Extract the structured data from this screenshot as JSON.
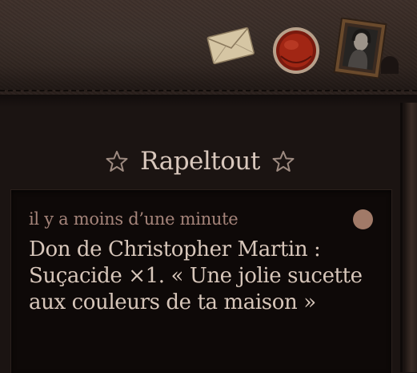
{
  "header": {
    "icons": [
      "mail-icon",
      "wax-seal-icon",
      "portrait-icon"
    ]
  },
  "panel": {
    "title": "Rapeltout",
    "title_icon": "star-outline-icon"
  },
  "notification": {
    "time": "il y a moins d’une minute",
    "message": "Don de Christopher Martin : Suçacide ×1. « Une jolie sucette aux couleurs de ta maison »",
    "unread": true
  },
  "colors": {
    "title_text": "#d9c8bd",
    "time_text": "#a5847a",
    "message_text": "#d7c6ba",
    "unread_dot": "#a17a68",
    "background": "#1b1412"
  }
}
